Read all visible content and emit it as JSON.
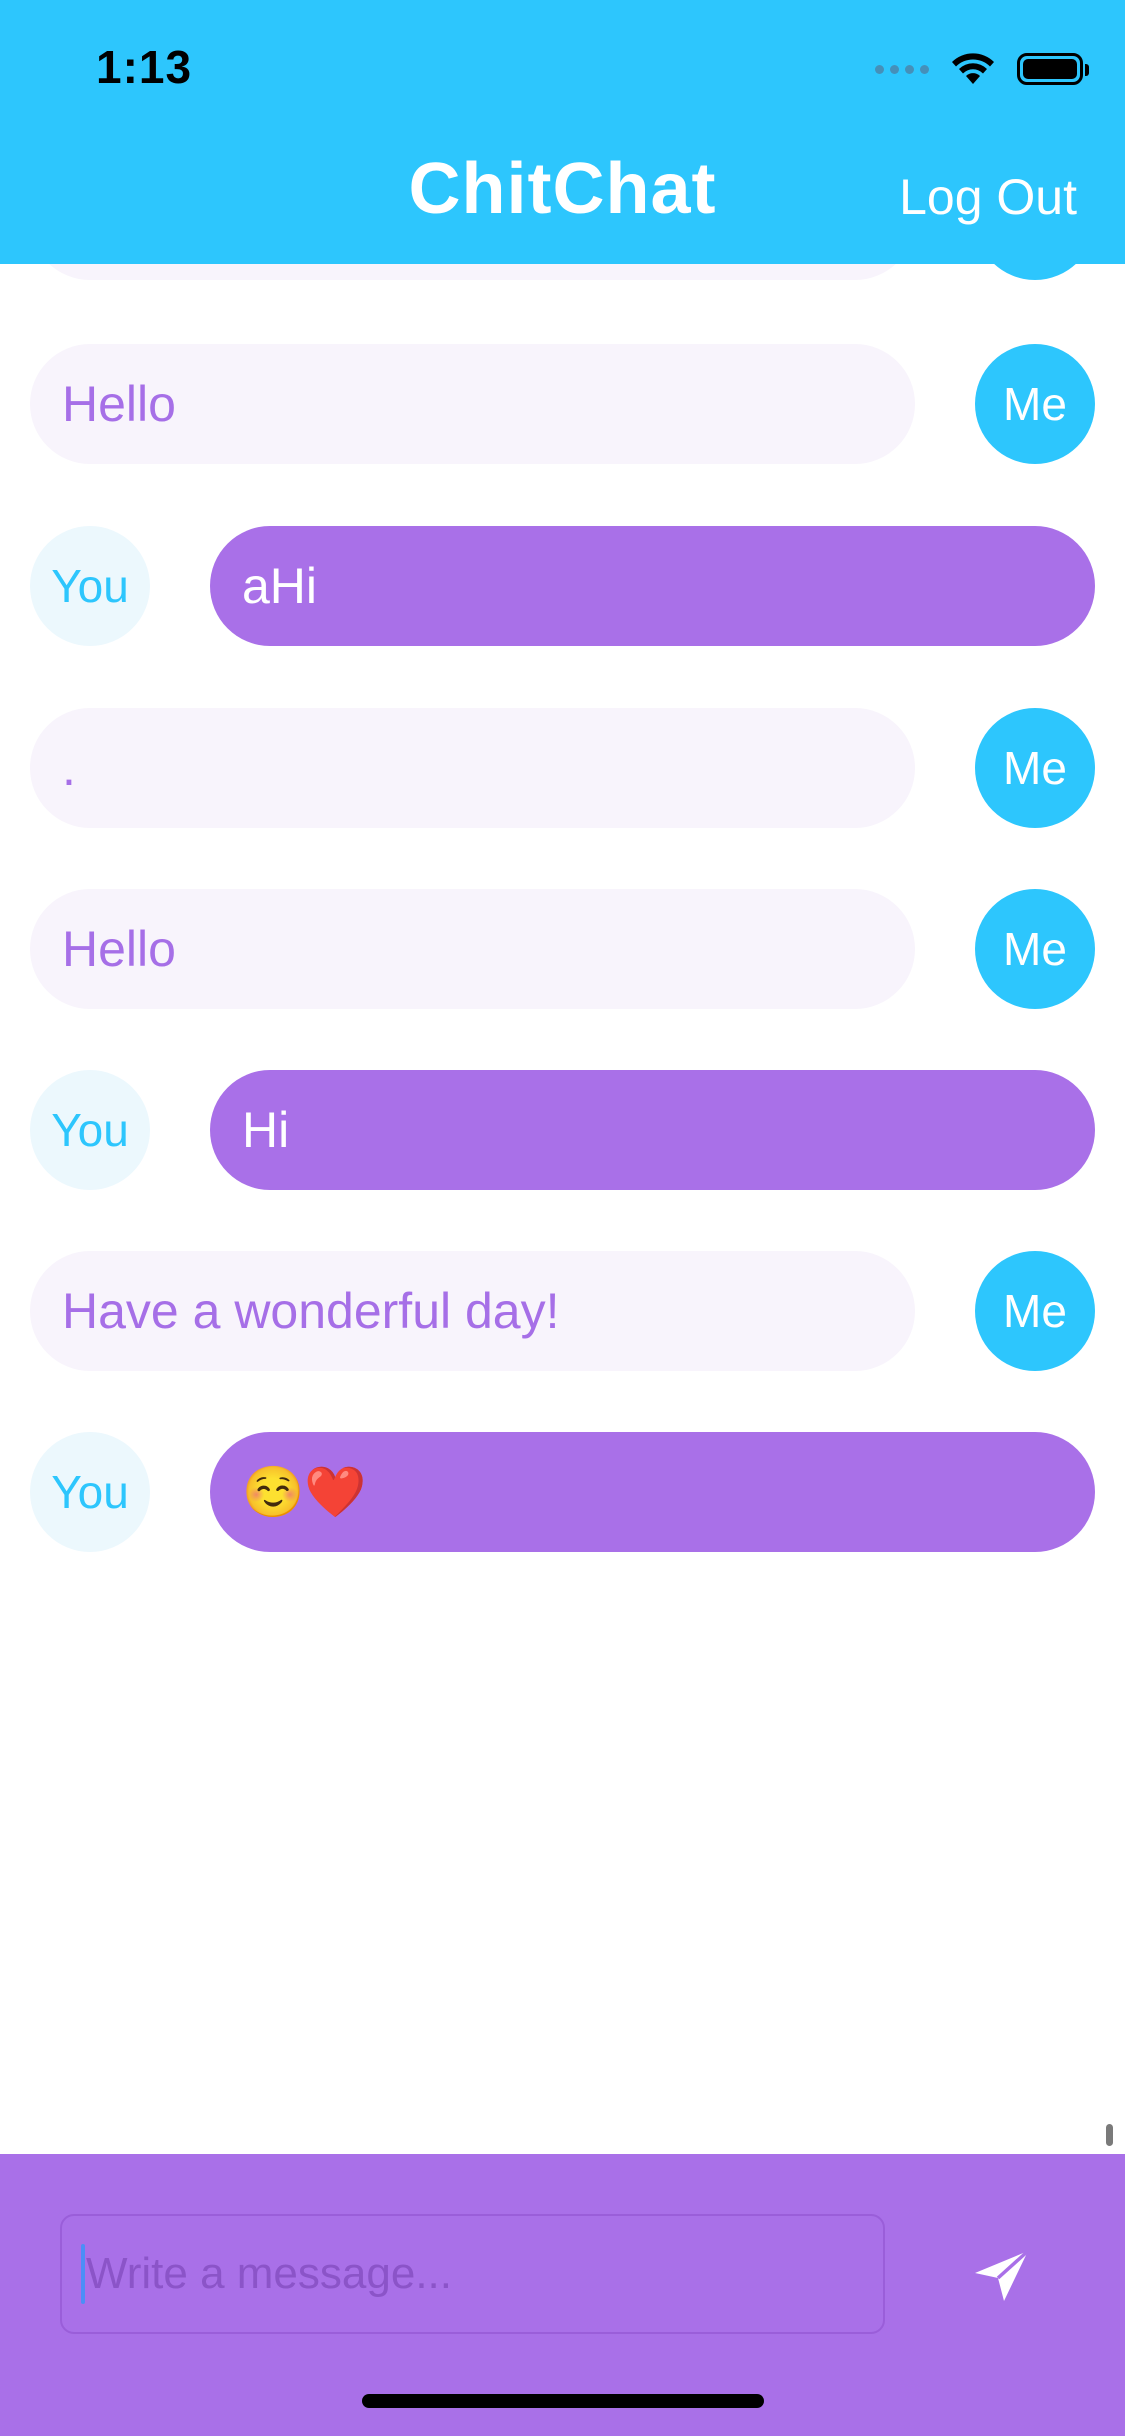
{
  "status_bar": {
    "time": "1:13"
  },
  "header": {
    "title": "ChitChat",
    "logout_label": "Log Out"
  },
  "messages": [
    {
      "sender": "me",
      "avatar_label": "Me",
      "text": "Hello"
    },
    {
      "sender": "you",
      "avatar_label": "You",
      "text": "aHi"
    },
    {
      "sender": "me",
      "avatar_label": "Me",
      "text": "."
    },
    {
      "sender": "me",
      "avatar_label": "Me",
      "text": "Hello"
    },
    {
      "sender": "you",
      "avatar_label": "You",
      "text": "Hi"
    },
    {
      "sender": "me",
      "avatar_label": "Me",
      "text": "Have a wonderful day!"
    },
    {
      "sender": "you",
      "avatar_label": "You",
      "text": "☺️❤️"
    }
  ],
  "composer": {
    "placeholder": "Write a message...",
    "value": ""
  },
  "icons": {
    "send": "send-icon",
    "wifi": "wifi-icon",
    "battery": "battery-icon",
    "signal": "signal-icon"
  },
  "colors": {
    "header": "#2dc6fd",
    "accent_purple": "#a970e8",
    "me_bubble": "#f8f4fc",
    "me_text": "#a66fe7",
    "you_avatar_bg": "#ecf8fd"
  }
}
